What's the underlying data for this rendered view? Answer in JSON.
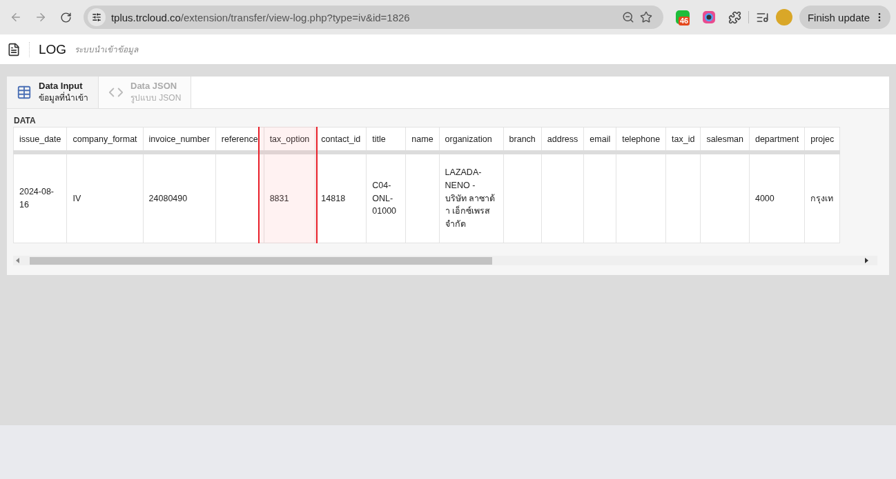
{
  "browser": {
    "url_host": "tplus.trcloud.co",
    "url_path": "/extension/transfer/view-log.php?type=iv&id=1826",
    "extension_badge": "46",
    "update_button": "Finish update"
  },
  "header": {
    "title": "LOG",
    "subtitle": "ระบบนำเข้าข้อมูล"
  },
  "tabs": [
    {
      "title": "Data Input",
      "subtitle": "ข้อมูลที่นำเข้า",
      "kind": "table",
      "selected": true
    },
    {
      "title": "Data JSON",
      "subtitle": "รูปแบบ JSON",
      "kind": "code",
      "selected": false
    }
  ],
  "section_label": "DATA",
  "table": {
    "columns": [
      {
        "label": "issue_date",
        "highlighted": false
      },
      {
        "label": "company_format",
        "highlighted": false
      },
      {
        "label": "invoice_number",
        "highlighted": false
      },
      {
        "label": "reference",
        "highlighted": false
      },
      {
        "label": "tax_option",
        "highlighted": true
      },
      {
        "label": "contact_id",
        "highlighted": false
      },
      {
        "label": "title",
        "highlighted": false
      },
      {
        "label": "name",
        "highlighted": false
      },
      {
        "label": "organization",
        "highlighted": false
      },
      {
        "label": "branch",
        "highlighted": false
      },
      {
        "label": "address",
        "highlighted": false
      },
      {
        "label": "email",
        "highlighted": false
      },
      {
        "label": "telephone",
        "highlighted": false
      },
      {
        "label": "tax_id",
        "highlighted": false
      },
      {
        "label": "salesman",
        "highlighted": false
      },
      {
        "label": "department",
        "highlighted": false
      },
      {
        "label": "projec",
        "highlighted": false
      }
    ],
    "rows": [
      {
        "cells": [
          "2024-08-16",
          "IV",
          "24080490",
          null,
          "8831",
          "14818",
          "C04-ONL-01000",
          null,
          "LAZADA-NENO - บริษัท ลาซาด้า เอ็กซ์เพรส จำกัด",
          null,
          null,
          null,
          null,
          null,
          null,
          "4000",
          "กรุงเท"
        ]
      }
    ]
  }
}
